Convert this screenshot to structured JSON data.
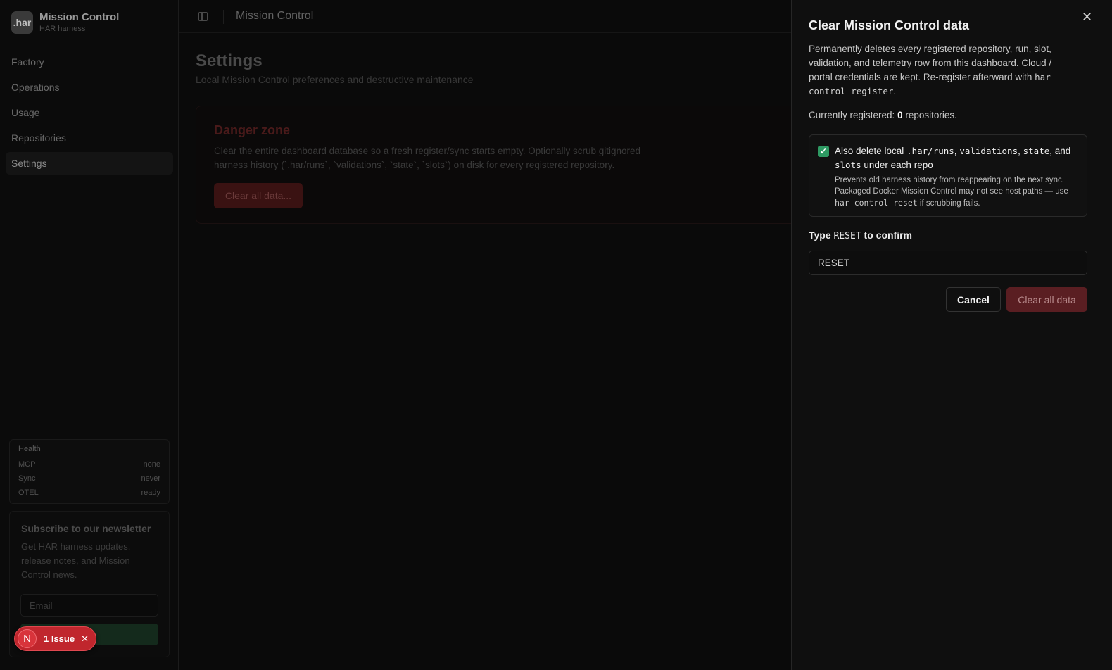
{
  "app": {
    "name": "Mission Control",
    "subtitle": "HAR harness",
    "logo_text": ".har"
  },
  "sidebar": {
    "items": [
      {
        "label": "Factory"
      },
      {
        "label": "Operations"
      },
      {
        "label": "Usage"
      },
      {
        "label": "Repositories"
      },
      {
        "label": "Settings",
        "active": true
      }
    ]
  },
  "health": {
    "title": "Health",
    "rows": [
      {
        "label": "MCP",
        "value": "none"
      },
      {
        "label": "Sync",
        "value": "never"
      },
      {
        "label": "OTEL",
        "value": "ready"
      }
    ]
  },
  "newsletter": {
    "title": "Subscribe to our newsletter",
    "description": "Get HAR harness updates, release notes, and Mission Control news.",
    "email_placeholder": "Email",
    "button_label": "be"
  },
  "issue_badge": {
    "avatar": "N",
    "text": "1 Issue"
  },
  "topbar": {
    "title": "Mission Control"
  },
  "page": {
    "title": "Settings",
    "subtitle": "Local Mission Control preferences and destructive maintenance"
  },
  "danger_zone": {
    "title": "Danger zone",
    "description": "Clear the entire dashboard database so a fresh register/sync starts empty. Optionally scrub gitignored harness history (`.har/runs`, `validations`, `state`, `slots`) on disk for every registered repository.",
    "button_label": "Clear all data..."
  },
  "drawer": {
    "title": "Clear Mission Control data",
    "description_text": "Permanently deletes every registered repository, run, slot, validation, and telemetry row from this dashboard. Cloud / portal credentials are kept. Re-register afterward with ",
    "description_code": "har control register",
    "description_end": ".",
    "count_prefix": "Currently registered: ",
    "count_value": "0",
    "count_suffix": " repositories.",
    "option": {
      "checked": true,
      "label_prefix": "Also delete local ",
      "code_runs": ".har/runs",
      "sep1": ", ",
      "code_validations": "validations",
      "sep2": ", ",
      "code_state": "state",
      "sep3": ", and ",
      "code_slots": "slots",
      "label_suffix": " under each repo",
      "help_text": "Prevents old harness history from reappearing on the next sync. Packaged Docker Mission Control may not see host paths — use ",
      "help_code": "har control reset",
      "help_end": " if scrubbing fails."
    },
    "confirm_label_prefix": "Type ",
    "confirm_label_code": "RESET",
    "confirm_label_suffix": " to confirm",
    "confirm_value": "RESET",
    "cancel_label": "Cancel",
    "clear_label": "Clear all data"
  },
  "colors": {
    "accent_green": "#2e9a63",
    "danger_red": "#5a1e22",
    "issue_red": "#c0262d"
  }
}
